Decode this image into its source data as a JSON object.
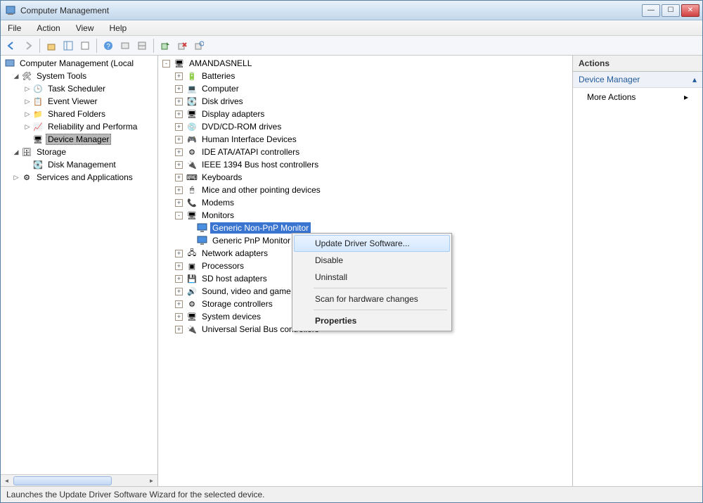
{
  "window": {
    "title": "Computer Management"
  },
  "menu": {
    "file": "File",
    "action": "Action",
    "view": "View",
    "help": "Help"
  },
  "left_tree": {
    "root": "Computer Management (Local",
    "system_tools": "System Tools",
    "task_scheduler": "Task Scheduler",
    "event_viewer": "Event Viewer",
    "shared_folders": "Shared Folders",
    "reliability": "Reliability and Performa",
    "device_manager": "Device Manager",
    "storage": "Storage",
    "disk_management": "Disk Management",
    "services": "Services and Applications"
  },
  "device_tree": {
    "computer": "AMANDASNELL",
    "batteries": "Batteries",
    "computer_cat": "Computer",
    "disk_drives": "Disk drives",
    "display_adapters": "Display adapters",
    "dvd": "DVD/CD-ROM drives",
    "hid": "Human Interface Devices",
    "ide": "IDE ATA/ATAPI controllers",
    "ieee1394": "IEEE 1394 Bus host controllers",
    "keyboards": "Keyboards",
    "mice": "Mice and other pointing devices",
    "modems": "Modems",
    "monitors": "Monitors",
    "monitor_nonpnp": "Generic Non-PnP Monitor",
    "monitor_pnp": "Generic PnP Monitor",
    "network": "Network adapters",
    "processors": "Processors",
    "sd": "SD host adapters",
    "sound": "Sound, video and game con",
    "storage_ctrl": "Storage controllers",
    "system_devices": "System devices",
    "usb": "Universal Serial Bus controllers"
  },
  "context_menu": {
    "update": "Update Driver Software...",
    "disable": "Disable",
    "uninstall": "Uninstall",
    "scan": "Scan for hardware changes",
    "properties": "Properties"
  },
  "actions": {
    "header": "Actions",
    "sub": "Device Manager",
    "more": "More Actions"
  },
  "status": "Launches the Update Driver Software Wizard for the selected device."
}
